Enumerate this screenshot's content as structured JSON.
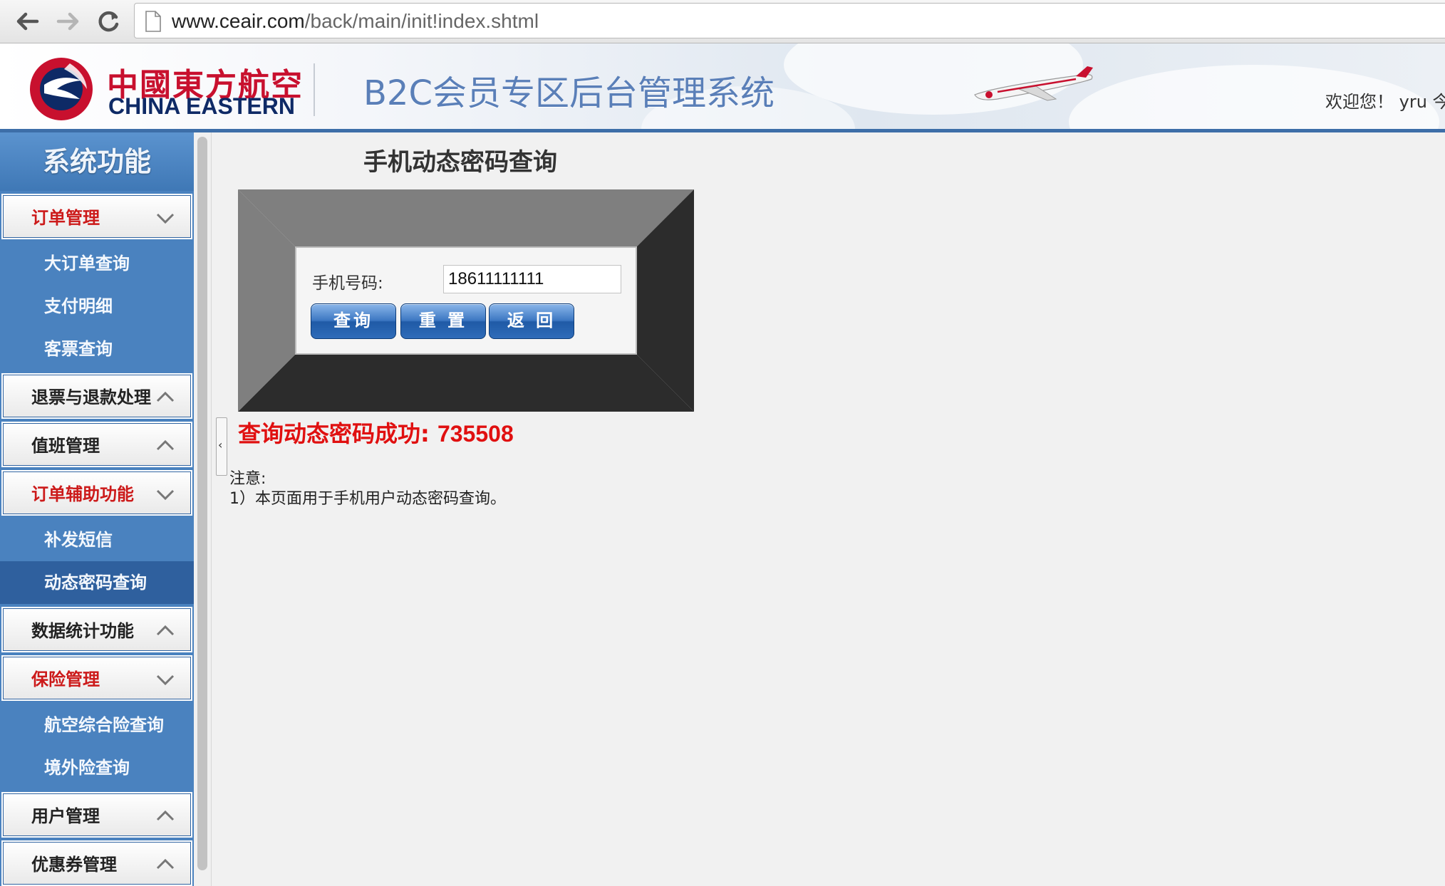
{
  "browser": {
    "url_domain": "www.ceair.com",
    "url_path": "/back/main/init!index.shtml"
  },
  "header": {
    "logo_cn": "中國東方航空",
    "logo_en": "CHINA EASTERN",
    "system_title": "B2C会员专区后台管理系统",
    "welcome": "欢迎您！ yru 今"
  },
  "sidebar": {
    "title": "系统功能",
    "sections": [
      {
        "label": "订单管理",
        "open": true,
        "items": [
          "大订单查询",
          "支付明细",
          "客票查询"
        ]
      },
      {
        "label": "退票与退款处理",
        "open": false,
        "items": []
      },
      {
        "label": "值班管理",
        "open": false,
        "items": []
      },
      {
        "label": "订单辅助功能",
        "open": true,
        "items": [
          "补发短信",
          "动态密码查询"
        ],
        "active_item": "动态密码查询"
      },
      {
        "label": "数据统计功能",
        "open": false,
        "items": []
      },
      {
        "label": "保险管理",
        "open": true,
        "items": [
          "航空综合险查询",
          "境外险查询"
        ]
      },
      {
        "label": "用户管理",
        "open": false,
        "items": []
      },
      {
        "label": "优惠券管理",
        "open": false,
        "items": []
      }
    ]
  },
  "main": {
    "title": "手机动态密码查询",
    "phone_label": "手机号码:",
    "phone_value": "18611111111",
    "buttons": {
      "query": "查询",
      "reset": "重 置",
      "back": "返 回"
    },
    "result_prefix": "查询动态密码成功:",
    "result_code": "735508",
    "note_title": "注意:",
    "note_line": "1）本页面用于手机用户动态密码查询。"
  },
  "colors": {
    "sidebar_bg": "#4a82bf",
    "sidebar_active": "#2f609e",
    "menu_open_text": "#cc1a1a",
    "result_text": "#e01010",
    "brand_red": "#c8102e",
    "brand_blue": "#0e2a66"
  }
}
